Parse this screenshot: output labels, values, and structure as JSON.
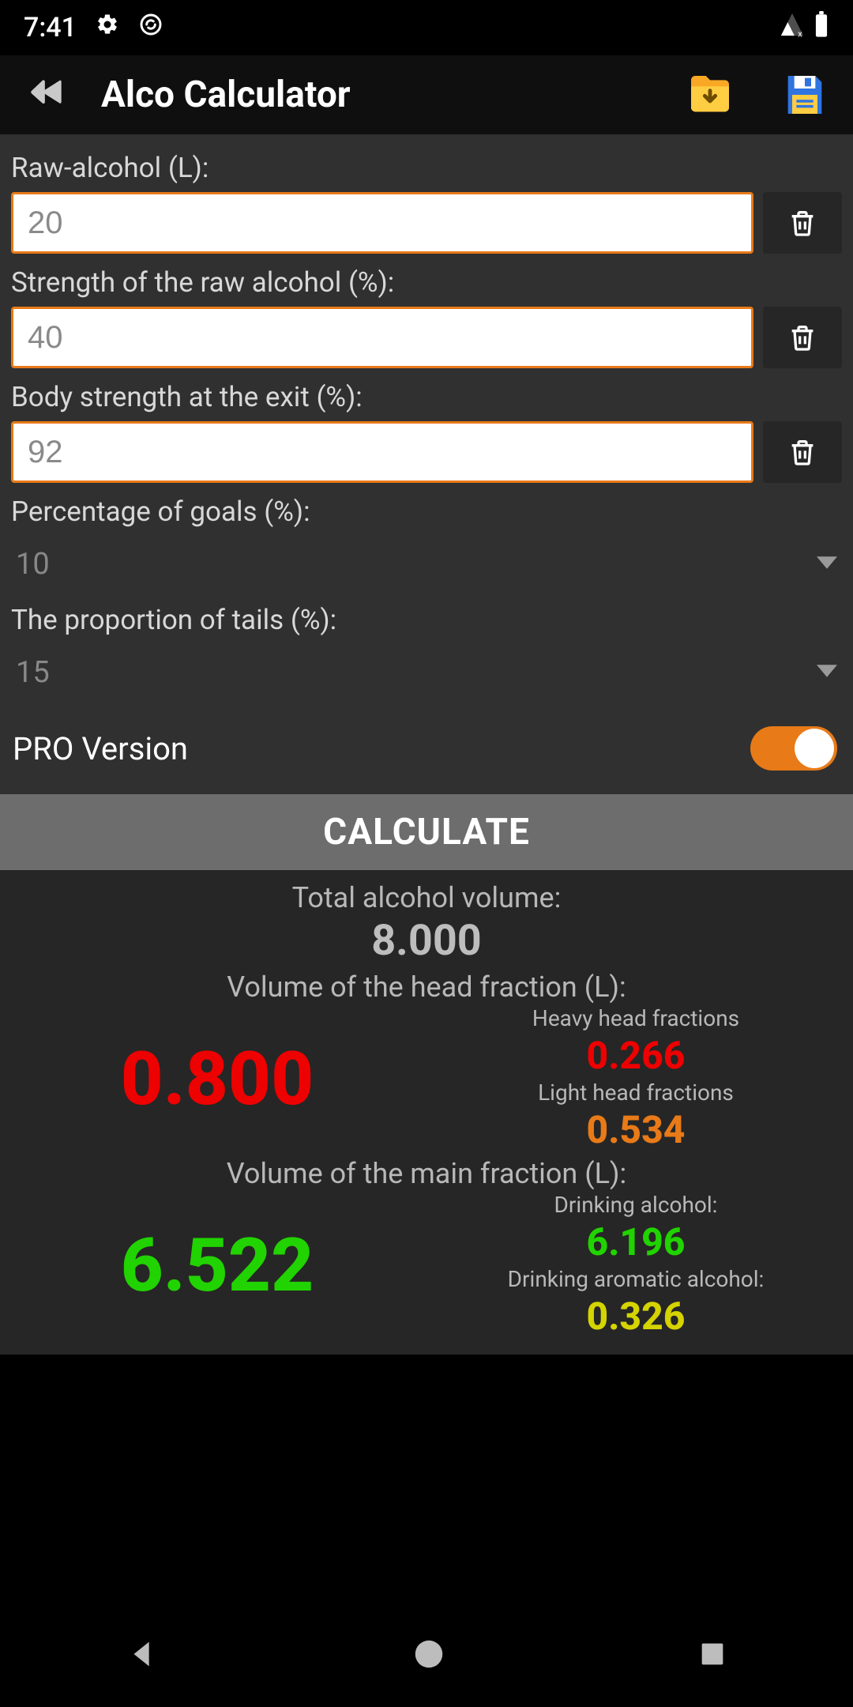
{
  "status": {
    "time": "7:41"
  },
  "app": {
    "title": "Alco Calculator"
  },
  "fields": {
    "raw_alcohol": {
      "label": "Raw-alcohol (L):",
      "value": "20"
    },
    "strength_raw": {
      "label": "Strength of the raw alcohol (%):",
      "value": "40"
    },
    "body_strength": {
      "label": "Body strength at the exit (%):",
      "value": "92"
    },
    "pct_goals": {
      "label": "Percentage of goals (%):",
      "value": "10"
    },
    "prop_tails": {
      "label": "The proportion of tails (%):",
      "value": "15"
    }
  },
  "pro": {
    "label": "PRO Version",
    "enabled": true
  },
  "calculate": {
    "label": "CALCULATE"
  },
  "results": {
    "total_label": "Total alcohol volume:",
    "total_value": "8.000",
    "head_label": "Volume of the head fraction (L):",
    "head_value": "0.800",
    "heavy_head_label": "Heavy head fractions",
    "heavy_head_value": "0.266",
    "light_head_label": "Light head fractions",
    "light_head_value": "0.534",
    "main_label": "Volume of the main fraction (L):",
    "main_value": "6.522",
    "drinking_label": "Drinking alcohol:",
    "drinking_value": "6.196",
    "aromatic_label": "Drinking aromatic alcohol:",
    "aromatic_value": "0.326"
  }
}
